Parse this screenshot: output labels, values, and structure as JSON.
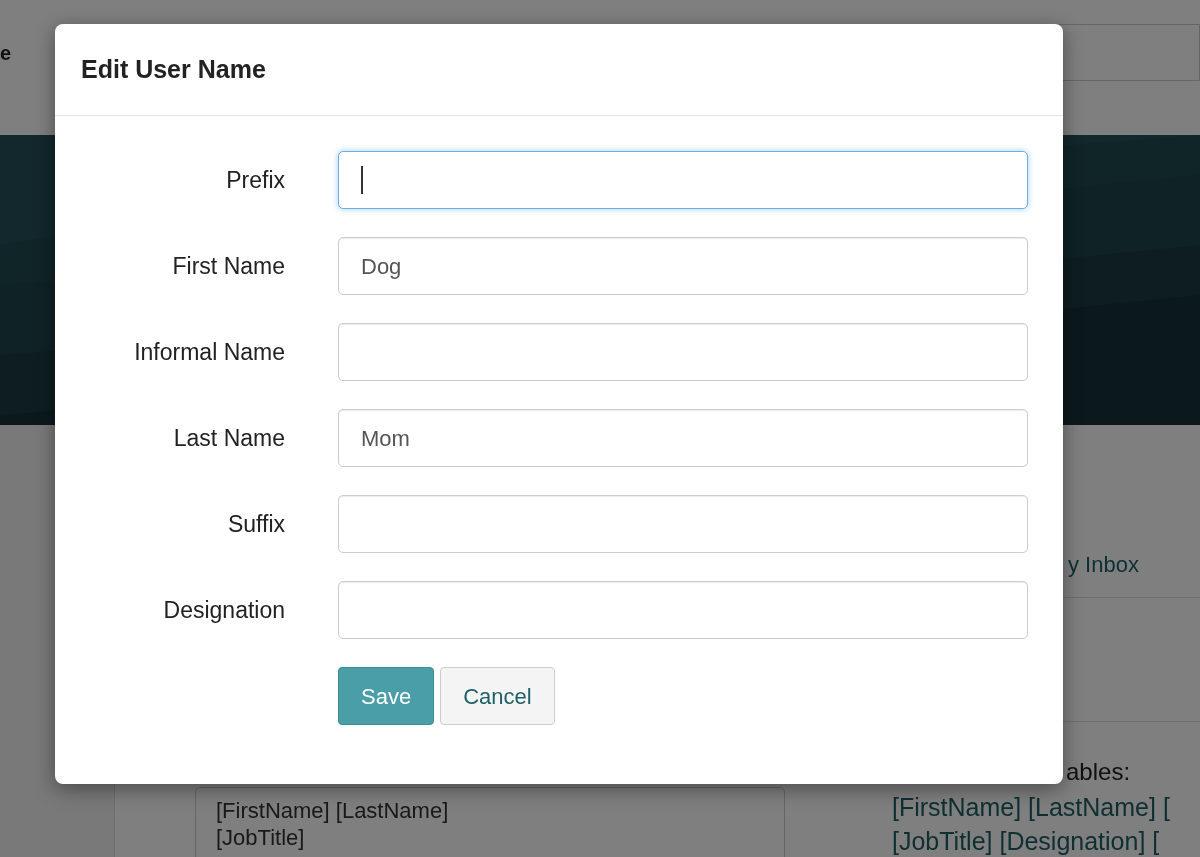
{
  "background": {
    "header_fragment": "e",
    "inbox_link": "y Inbox",
    "variables_heading": "ables:",
    "variable_lines": [
      "[FirstName] [LastName] [",
      "[JobTitle] [Designation] ["
    ],
    "template_lines": [
      "[FirstName] [LastName]",
      "[JobTitle]"
    ]
  },
  "dialog": {
    "title": "Edit User Name",
    "fields": [
      {
        "label": "Prefix",
        "focused": true
      },
      {
        "label": "First Name",
        "value": "Dog",
        "focused": false
      },
      {
        "label": "Informal Name",
        "focused": false
      },
      {
        "label": "Last Name",
        "value": "Mom",
        "focused": false
      },
      {
        "label": "Suffix",
        "focused": false
      },
      {
        "label": "Designation",
        "focused": false
      }
    ],
    "buttons": [
      {
        "label": "Save",
        "kind": "primary"
      },
      {
        "label": "Cancel",
        "kind": "secondary"
      }
    ]
  }
}
